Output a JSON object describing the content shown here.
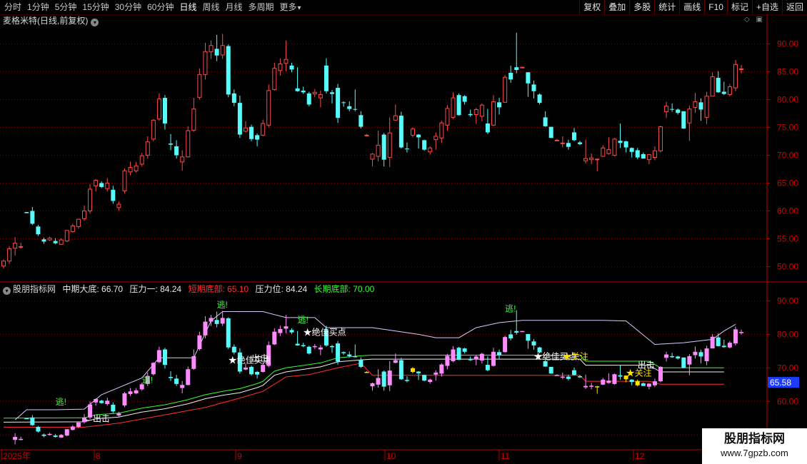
{
  "toolbar": {
    "periods": [
      "分时",
      "1分钟",
      "5分钟",
      "15分钟",
      "30分钟",
      "60分钟",
      "日线",
      "周线",
      "月线",
      "多周期",
      "更多"
    ],
    "active_period": "日线",
    "more_arrow": "▾",
    "actions": [
      "复权",
      "叠加",
      "多股",
      "统计",
      "画线",
      "F10",
      "标记",
      "+自选",
      "返回"
    ]
  },
  "stock": {
    "title": "麦格米特(日线,前复权)",
    "dropdown_icon": "chevron-down-icon"
  },
  "indicator": {
    "name": "股朋指标网",
    "mid_bottom": "中期大底: 66.70",
    "pressure1": "压力一: 84.24",
    "short_bottom": "短期底部: 65.10",
    "pressure": "压力位: 84.24",
    "long_bottom": "长期底部: 70.00"
  },
  "colors": {
    "up": "#ff4a4a",
    "down": "#54fcfc",
    "grid": "#7a0000",
    "axis": "#b40000",
    "white": "#ffffff",
    "yellow": "#ffe000",
    "pink": "#ff8cff",
    "green": "#33ff33",
    "red": "#ff3030",
    "lavender": "#dcc8ff"
  },
  "price_axis": {
    "labels": [
      "90.00",
      "85.00",
      "80.00",
      "75.00",
      "70.00",
      "65.00",
      "60.00",
      "55.00",
      "50.00"
    ]
  },
  "ind_axis": {
    "labels": [
      "90.00",
      "80.00",
      "70.00",
      "60.00",
      "50.00"
    ],
    "current": "65.58"
  },
  "date_axis": {
    "labels": [
      "2025年",
      "8",
      "9",
      "10",
      "11",
      "12"
    ]
  },
  "annotations": {
    "escape": "逃!",
    "exit": "←出击",
    "exit2": "出击",
    "best_buy": "★绝佳买点",
    "focus": "★关注"
  },
  "watermark": {
    "line1": "股朋指标网",
    "line2": "www.7gpzb.com"
  },
  "chart_data": {
    "type": "candlestick",
    "title": "麦格米特(日线,前复权)",
    "ylim": [
      47.5,
      93.0
    ],
    "candles": [
      [
        50.1,
        51.3,
        49.7,
        51.0
      ],
      [
        51.0,
        53.7,
        50.5,
        53.2
      ],
      [
        53.3,
        55.3,
        52.0,
        54.2
      ],
      [
        53.6,
        54.3,
        53.2,
        53.6
      ],
      [
        59.8,
        59.8,
        59.6,
        59.6
      ],
      [
        60.0,
        60.7,
        57.5,
        57.7
      ],
      [
        57.2,
        57.5,
        55.5,
        55.8
      ],
      [
        54.9,
        55.2,
        54.1,
        54.5
      ],
      [
        54.8,
        55.4,
        54.6,
        55.1
      ],
      [
        54.6,
        55.1,
        54.0,
        54.2
      ],
      [
        54.0,
        55.1,
        53.9,
        54.8
      ],
      [
        54.6,
        56.5,
        54.4,
        56.5
      ],
      [
        56.3,
        57.7,
        56.1,
        57.3
      ],
      [
        57.2,
        58.6,
        56.8,
        58.5
      ],
      [
        58.6,
        61.0,
        58.2,
        60.0
      ],
      [
        60.0,
        64.8,
        59.5,
        63.9
      ],
      [
        64.5,
        65.7,
        63.5,
        65.5
      ],
      [
        65.0,
        65.3,
        64.1,
        64.3
      ],
      [
        64.0,
        65.9,
        63.5,
        65.0
      ],
      [
        63.8,
        64.5,
        61.3,
        61.8
      ],
      [
        60.6,
        61.7,
        60.0,
        61.2
      ],
      [
        63.6,
        67.6,
        63.1,
        67.2
      ],
      [
        67.0,
        68.8,
        66.4,
        67.8
      ],
      [
        67.2,
        68.8,
        66.9,
        68.1
      ],
      [
        68.4,
        70.4,
        68.0,
        69.9
      ],
      [
        70.0,
        73.4,
        69.4,
        72.4
      ],
      [
        72.9,
        76.5,
        72.5,
        76.3
      ],
      [
        76.5,
        81.1,
        76.2,
        80.1
      ],
      [
        80.3,
        80.8,
        74.6,
        75.7
      ],
      [
        72.1,
        73.8,
        70.9,
        71.9
      ],
      [
        71.6,
        72.7,
        69.4,
        70.0
      ],
      [
        68.8,
        70.9,
        67.2,
        69.7
      ],
      [
        69.7,
        75.2,
        69.6,
        74.4
      ],
      [
        74.5,
        80.3,
        74.2,
        78.3
      ],
      [
        80.4,
        85.6,
        80.0,
        84.5
      ],
      [
        84.5,
        90.2,
        83.6,
        88.6
      ],
      [
        88.6,
        90.6,
        87.3,
        89.7
      ],
      [
        89.1,
        91.6,
        86.9,
        87.9
      ],
      [
        88.0,
        91.8,
        87.3,
        89.7
      ],
      [
        89.6,
        89.9,
        80.4,
        80.9
      ],
      [
        81.1,
        81.8,
        78.8,
        79.4
      ],
      [
        79.4,
        80.7,
        73.1,
        73.7
      ],
      [
        74.3,
        76.1,
        74.1,
        74.9
      ],
      [
        75.1,
        75.5,
        72.5,
        72.9
      ],
      [
        73.6,
        73.9,
        71.6,
        72.8
      ],
      [
        73.6,
        76.4,
        73.4,
        75.7
      ],
      [
        75.4,
        82.7,
        75.0,
        81.6
      ],
      [
        81.8,
        86.6,
        81.6,
        85.6
      ],
      [
        85.2,
        87.4,
        84.3,
        86.4
      ],
      [
        86.5,
        90.6,
        85.1,
        87.2
      ],
      [
        86.1,
        86.6,
        84.9,
        85.4
      ],
      [
        82.0,
        85.8,
        81.4,
        81.5
      ],
      [
        81.6,
        82.3,
        81.0,
        81.3
      ],
      [
        81.1,
        81.4,
        78.8,
        79.1
      ],
      [
        81.0,
        81.9,
        80.4,
        81.3
      ],
      [
        80.3,
        81.6,
        78.6,
        80.9
      ],
      [
        86.1,
        87.4,
        81.1,
        81.5
      ],
      [
        81.3,
        81.7,
        79.3,
        81.0
      ],
      [
        82.1,
        82.8,
        75.8,
        76.7
      ],
      [
        79.5,
        79.7,
        78.7,
        79.4
      ],
      [
        78.8,
        79.7,
        77.9,
        78.3
      ],
      [
        78.3,
        81.8,
        77.9,
        78.2
      ],
      [
        77.2,
        77.9,
        74.8,
        75.1
      ],
      [
        73.6,
        73.8,
        73.5,
        73.6
      ],
      [
        69.3,
        70.4,
        68.0,
        70.2
      ],
      [
        69.8,
        74.4,
        68.9,
        71.8
      ],
      [
        73.7,
        74.0,
        68.0,
        69.2
      ],
      [
        69.6,
        76.8,
        67.9,
        74.0
      ],
      [
        76.3,
        79.1,
        76.2,
        77.1
      ],
      [
        77.1,
        77.8,
        71.2,
        71.4
      ],
      [
        71.2,
        72.3,
        70.5,
        71.1
      ],
      [
        73.6,
        75.0,
        73.2,
        74.7
      ],
      [
        73.7,
        73.8,
        71.2,
        73.2
      ],
      [
        72.7,
        72.8,
        70.8,
        71.0
      ],
      [
        70.6,
        71.6,
        70.1,
        71.3
      ],
      [
        72.8,
        74.1,
        71.0,
        73.4
      ],
      [
        73.1,
        76.2,
        72.2,
        75.8
      ],
      [
        75.4,
        79.0,
        74.4,
        78.4
      ],
      [
        76.8,
        81.3,
        76.5,
        80.3
      ],
      [
        80.8,
        81.1,
        77.1,
        77.2
      ],
      [
        80.6,
        80.8,
        79.1,
        79.6
      ],
      [
        77.4,
        78.2,
        76.9,
        77.2
      ],
      [
        77.3,
        78.5,
        75.6,
        78.2
      ],
      [
        77.0,
        79.3,
        76.1,
        79.0
      ],
      [
        75.7,
        78.3,
        73.8,
        74.1
      ],
      [
        75.4,
        80.8,
        75.2,
        79.6
      ],
      [
        79.5,
        80.3,
        77.3,
        78.6
      ],
      [
        79.5,
        84.4,
        79.4,
        84.0
      ],
      [
        84.8,
        86.1,
        83.0,
        83.6
      ],
      [
        85.8,
        92.0,
        84.7,
        85.3
      ],
      [
        85.7,
        85.8,
        85.7,
        85.8
      ],
      [
        84.9,
        84.4,
        80.5,
        82.9
      ],
      [
        82.7,
        83.4,
        80.2,
        81.5
      ],
      [
        80.9,
        81.1,
        79.1,
        79.4
      ],
      [
        76.8,
        77.9,
        75.1,
        75.2
      ],
      [
        75.1,
        75.1,
        73.1,
        73.1
      ],
      [
        72.7,
        72.9,
        72.6,
        72.7
      ],
      [
        72.1,
        73.4,
        71.4,
        72.2
      ],
      [
        72.2,
        72.8,
        71.0,
        71.5
      ],
      [
        74.1,
        74.9,
        72.5,
        72.7
      ],
      [
        72.3,
        72.6,
        71.8,
        72.0
      ],
      [
        69.0,
        72.8,
        68.5,
        69.4
      ],
      [
        69.2,
        70.3,
        68.4,
        69.5
      ],
      [
        69.2,
        69.4,
        67.1,
        69.3
      ],
      [
        69.8,
        71.8,
        69.7,
        71.3
      ],
      [
        70.3,
        73.2,
        70.1,
        71.0
      ],
      [
        70.0,
        73.1,
        69.8,
        72.9
      ],
      [
        72.6,
        75.7,
        71.3,
        72.2
      ],
      [
        72.5,
        72.6,
        70.5,
        71.4
      ],
      [
        71.3,
        71.4,
        69.6,
        70.6
      ],
      [
        70.9,
        71.3,
        69.3,
        69.6
      ],
      [
        70.2,
        70.5,
        69.4,
        69.4
      ],
      [
        69.2,
        70.2,
        68.4,
        70.1
      ],
      [
        69.6,
        71.6,
        69.1,
        70.8
      ],
      [
        70.8,
        75.3,
        70.5,
        75.1
      ],
      [
        77.8,
        79.6,
        76.7,
        78.8
      ],
      [
        78.3,
        79.3,
        77.8,
        78.2
      ],
      [
        78.2,
        78.4,
        77.3,
        77.6
      ],
      [
        77.9,
        77.9,
        74.7,
        74.8
      ],
      [
        75.8,
        78.9,
        72.6,
        78.3
      ],
      [
        78.6,
        81.2,
        77.6,
        79.6
      ],
      [
        79.5,
        80.2,
        76.2,
        78.2
      ],
      [
        76.8,
        81.4,
        75.6,
        80.6
      ],
      [
        80.6,
        84.9,
        80.6,
        84.1
      ],
      [
        83.9,
        85.1,
        81.2,
        81.3
      ],
      [
        81.4,
        83.2,
        80.8,
        81.0
      ],
      [
        80.9,
        82.8,
        80.6,
        82.3
      ],
      [
        82.1,
        87.1,
        81.5,
        86.3
      ],
      [
        85.4,
        86.2,
        84.7,
        85.5
      ]
    ],
    "indicator": {
      "name": "股朋指标网",
      "mid_bottom": 66.7,
      "pressure1": 84.24,
      "short_bottom": 65.1,
      "pressure": 84.24,
      "long_bottom": 70.0,
      "ylim": [
        46.0,
        95.0
      ]
    }
  }
}
